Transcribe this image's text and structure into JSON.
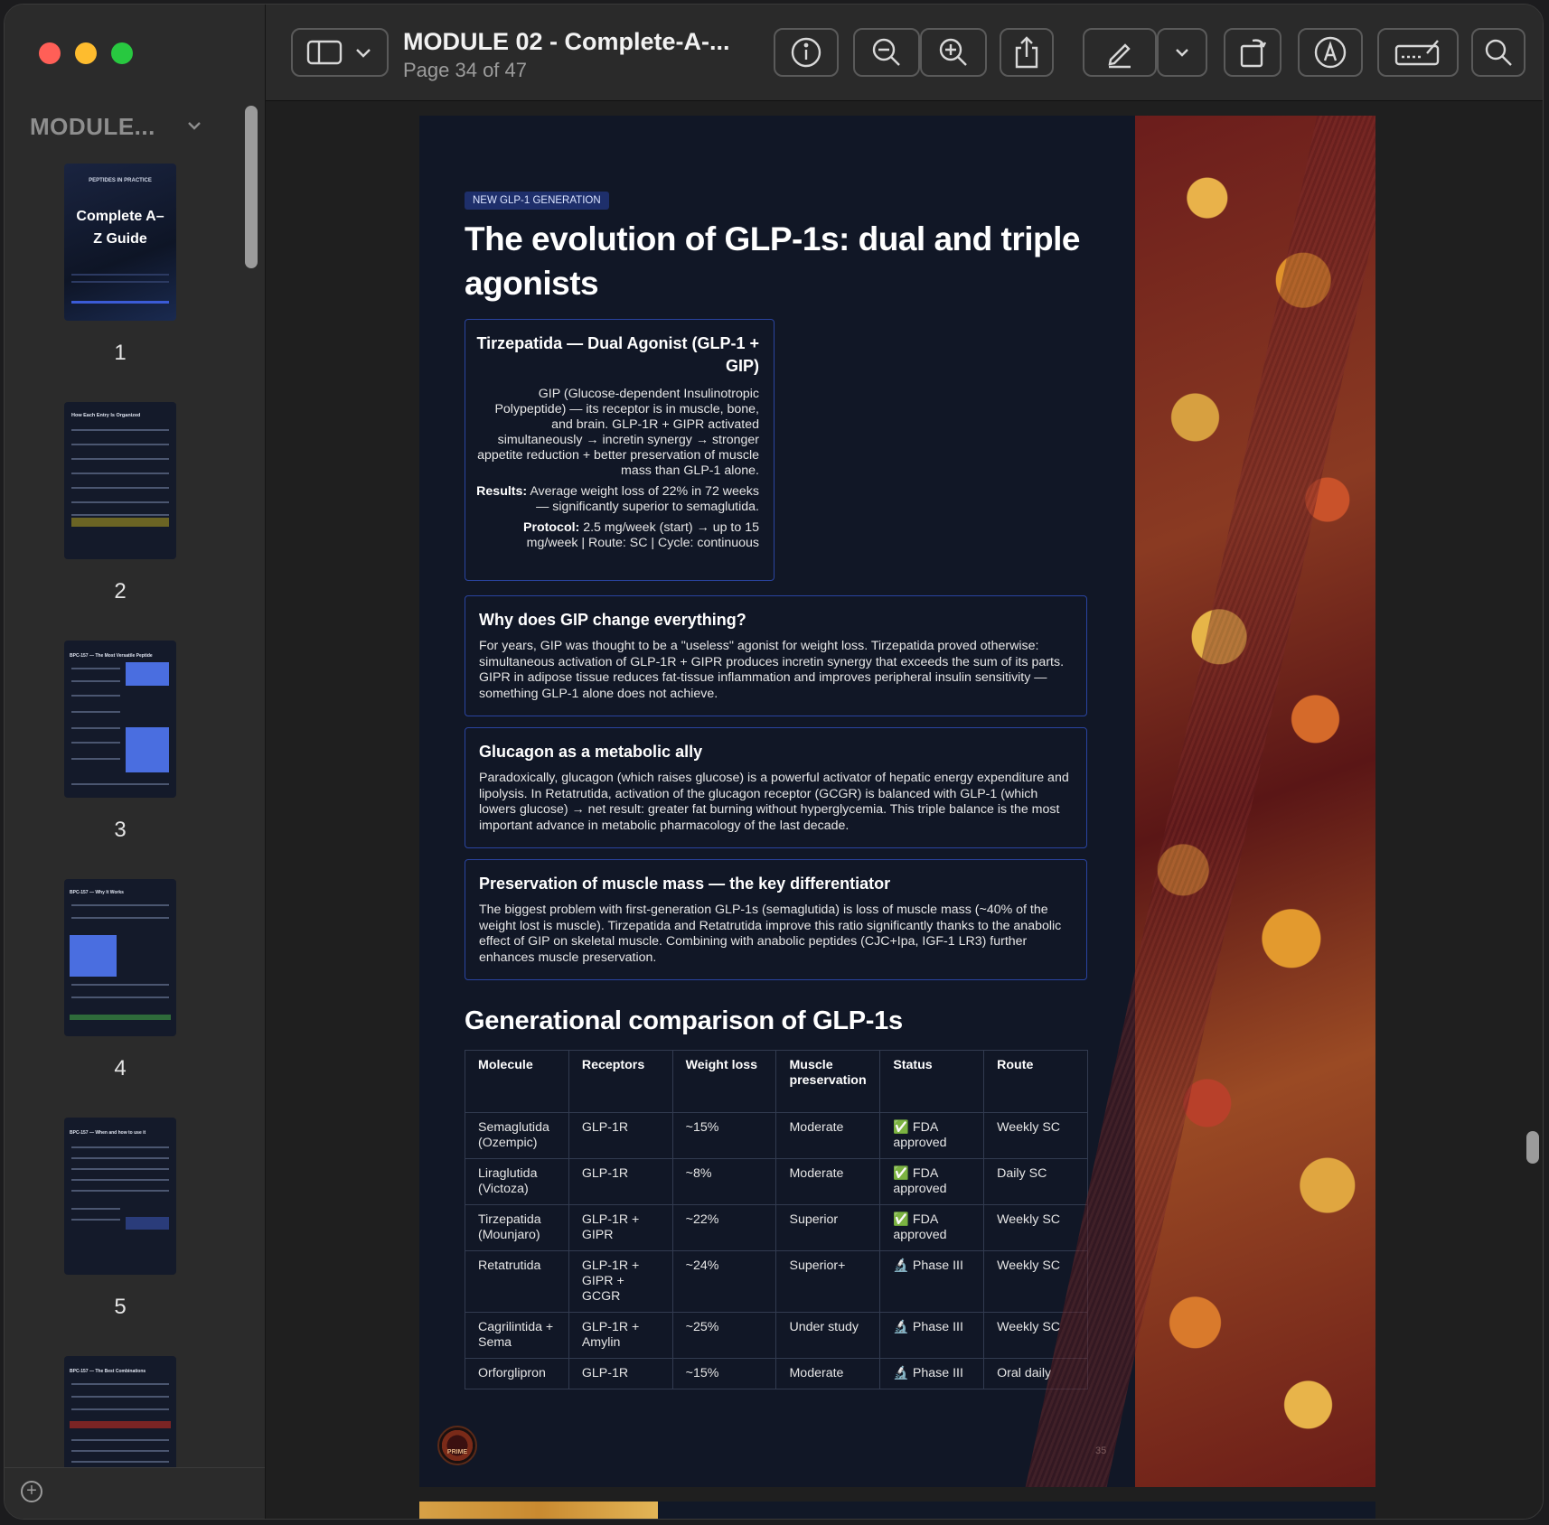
{
  "window": {
    "title": "MODULE 02 - Complete-A-...",
    "page_indicator": "Page 34 of 47"
  },
  "sidebar": {
    "title": "MODULE...",
    "thumbnails": [
      {
        "number": "1",
        "title": "Complete A–Z Guide",
        "header": "PEPTIDES IN PRACTICE"
      },
      {
        "number": "2",
        "title": "How Each Entry Is Organized"
      },
      {
        "number": "3",
        "title": "BPC-157 — The Most Versatile Peptide"
      },
      {
        "number": "4",
        "title": "BPC-157 — Why It Works"
      },
      {
        "number": "5",
        "title": "BPC-157 — When and how to use it"
      },
      {
        "number": "",
        "title": "BPC-157 — The Best Combinations"
      }
    ]
  },
  "toolbar": {
    "icons": [
      "sidebar-icon",
      "chevron-down-icon",
      "info-icon",
      "zoom-out-icon",
      "zoom-in-icon",
      "share-icon",
      "markup-pen-icon",
      "chevron-down-icon",
      "rotate-icon",
      "annotate-icon",
      "signature-icon",
      "search-icon"
    ]
  },
  "page": {
    "tag": "NEW GLP-1 GENERATION",
    "title": "The evolution of GLP-1s: dual and triple agonists",
    "tirzepatida_box": {
      "heading": "Tirzepatida — Dual Agonist (GLP-1 + GIP)",
      "body": "GIP (Glucose-dependent Insulinotropic Polypeptide) — its receptor is in muscle, bone, and brain. GLP-1R + GIPR activated simultaneously → incretin synergy → stronger appetite reduction + better preservation of muscle mass than GLP-1 alone.",
      "results_label": "Results:",
      "results_text": " Average weight loss of 22% in 72 weeks — significantly superior to semaglutida.",
      "protocol_label": "Protocol:",
      "protocol_text": " 2.5 mg/week (start) → up to 15 mg/week | Route: SC | Cycle: continuous"
    },
    "gip_box": {
      "heading": "Why does GIP change everything?",
      "body": "For years, GIP was thought to be a \"useless\" agonist for weight loss. Tirzepatida proved otherwise: simultaneous activation of GLP-1R + GIPR produces incretin synergy that exceeds the sum of its parts. GIPR in adipose tissue reduces fat-tissue inflammation and improves peripheral insulin sensitivity — something GLP-1 alone does not achieve."
    },
    "glucagon_box": {
      "heading": "Glucagon as a metabolic ally",
      "body": "Paradoxically, glucagon (which raises glucose) is a powerful activator of hepatic energy expenditure and lipolysis. In Retatrutida, activation of the glucagon receptor (GCGR) is balanced with GLP-1 (which lowers glucose) → net result: greater fat burning without hyperglycemia. This triple balance is the most important advance in metabolic pharmacology of the last decade."
    },
    "muscle_box": {
      "heading": "Preservation of muscle mass — the key differentiator",
      "body": "The biggest problem with first-generation GLP-1s (semaglutida) is loss of muscle mass (~40% of the weight lost is muscle). Tirzepatida and Retatrutida improve this ratio significantly thanks to the anabolic effect of GIP on skeletal muscle. Combining with anabolic peptides (CJC+Ipa, IGF-1 LR3) further enhances muscle preservation."
    },
    "comparison_title": "Generational comparison of GLP-1s",
    "table": {
      "headers": [
        "Molecule",
        "Receptors",
        "Weight loss",
        "Muscle preservation",
        "Status",
        "Route"
      ],
      "rows": [
        [
          "Semaglutida (Ozempic)",
          "GLP-1R",
          "~15%",
          "Moderate",
          "✅ FDA approved",
          "Weekly SC"
        ],
        [
          "Liraglutida (Victoza)",
          "GLP-1R",
          "~8%",
          "Moderate",
          "✅ FDA approved",
          "Daily SC"
        ],
        [
          "Tirzepatida (Mounjaro)",
          "GLP-1R + GIPR",
          "~22%",
          "Superior",
          "✅ FDA approved",
          "Weekly SC"
        ],
        [
          "Retatrutida",
          "GLP-1R + GIPR + GCGR",
          "~24%",
          "Superior+",
          "🔬 Phase III",
          "Weekly SC"
        ],
        [
          "Cagrilintida + Sema",
          "GLP-1R + Amylin",
          "~25%",
          "Under study",
          "🔬 Phase III",
          "Weekly SC"
        ],
        [
          "Orforglipron",
          "GLP-1R",
          "~15%",
          "Moderate",
          "🔬 Phase III",
          "Oral daily"
        ]
      ]
    },
    "page_number": "35",
    "logo_text": "PRIME"
  }
}
